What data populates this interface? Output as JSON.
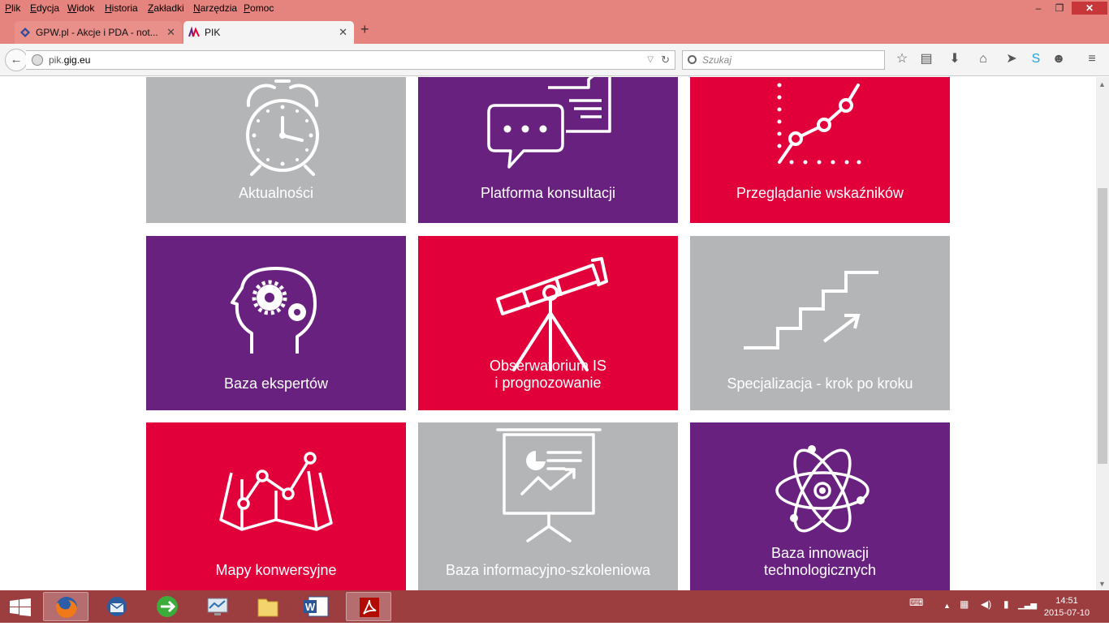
{
  "menu": {
    "items": [
      "Plik",
      "Edycja",
      "Widok",
      "Historia",
      "Zakładki",
      "Narzędzia",
      "Pomoc"
    ]
  },
  "window": {
    "minimize": "–",
    "maximize": "❐",
    "close": "✕"
  },
  "tabs": [
    {
      "title": "GPW.pl - Akcje i PDA - not...",
      "close": "✕"
    },
    {
      "title": "PIK",
      "close": "✕"
    }
  ],
  "newtab": "+",
  "nav": {
    "url_prefix": "pik.",
    "url_domain": "gig.eu",
    "search_placeholder": "Szukaj"
  },
  "tiles": [
    {
      "label": "Aktualności",
      "color": "gray",
      "icon": "alarm-clock-icon"
    },
    {
      "label": "Platforma konsultacji",
      "color": "purple",
      "icon": "chat-bubbles-icon"
    },
    {
      "label": "Przeglądanie wskaźników",
      "color": "red",
      "icon": "line-chart-icon"
    },
    {
      "label": "Baza ekspertów",
      "color": "purple",
      "icon": "head-gears-icon"
    },
    {
      "label1": "Obserwatorium IS",
      "label2": "i prognozowanie",
      "color": "red",
      "icon": "telescope-icon"
    },
    {
      "label": "Specjalizacja - krok po kroku",
      "color": "gray",
      "icon": "stairs-arrow-icon"
    },
    {
      "label": "Mapy konwersyjne",
      "color": "red",
      "icon": "map-chart-icon"
    },
    {
      "label": "Baza informacyjno-szkoleniowa",
      "color": "gray",
      "icon": "presentation-board-icon"
    },
    {
      "label1": "Baza innowacji",
      "label2": "technologicznych",
      "color": "purple",
      "icon": "atom-icon"
    }
  ],
  "colors": {
    "gray": "#b4b5b7",
    "purple": "#68217f",
    "red": "#e2003a",
    "chrome": "#e5847f",
    "taskbar": "#9c3d3f"
  },
  "clock": {
    "time": "14:51",
    "date": "2015-07-10"
  }
}
